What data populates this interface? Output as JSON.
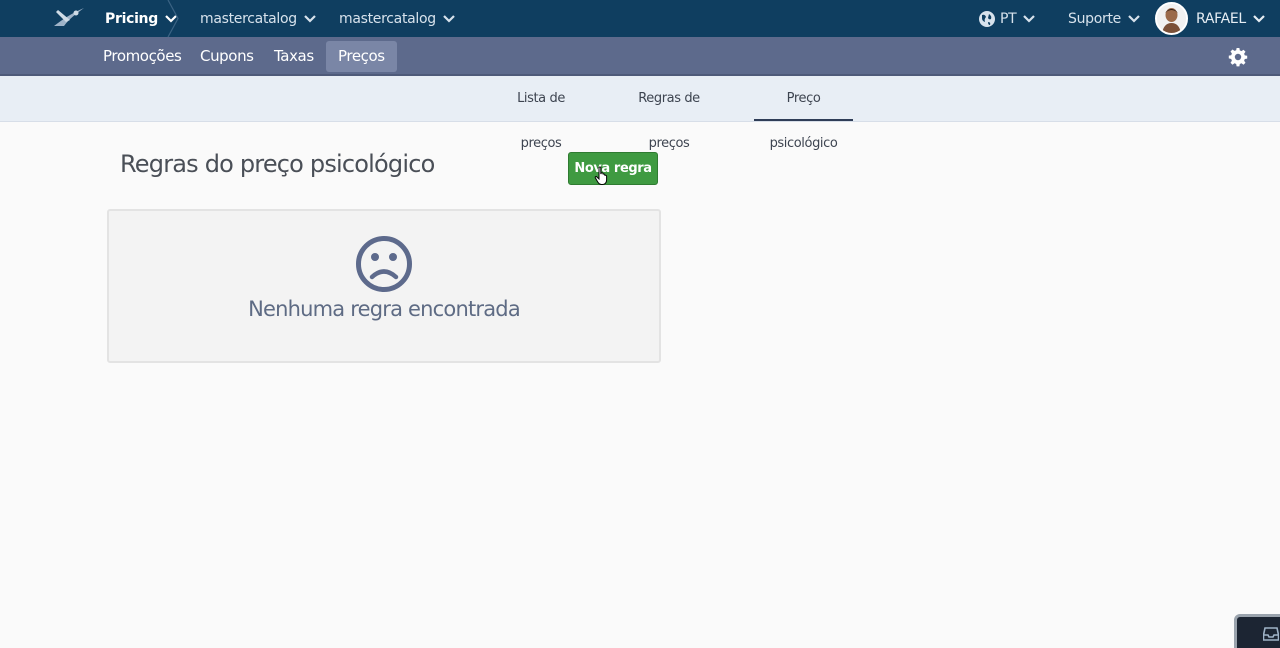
{
  "topbar": {
    "app_label": "Pricing",
    "breadcrumb": [
      "mastercatalog",
      "mastercatalog"
    ],
    "language": "PT",
    "support_label": "Suporte",
    "user_name": "RAFAEL"
  },
  "nav": {
    "items": [
      {
        "label": "Promoções",
        "active": false
      },
      {
        "label": "Cupons",
        "active": false
      },
      {
        "label": "Taxas",
        "active": false
      },
      {
        "label": "Preços",
        "active": true
      }
    ]
  },
  "subtabs": {
    "items": [
      {
        "label": "Lista de preços",
        "active": false
      },
      {
        "label": "Regras de preços",
        "active": false
      },
      {
        "label": "Preço psicológico",
        "active": true
      }
    ]
  },
  "main": {
    "title": "Regras do preço psicológico",
    "new_rule_button": "Nova regra",
    "empty_message": "Nenhuma regra encontrada"
  },
  "icons": [
    "logo-icon",
    "chevron-down-icon",
    "globe-icon",
    "avatar",
    "gear-icon",
    "sad-face-icon",
    "inbox-icon",
    "pointer-cursor-icon"
  ],
  "colors": {
    "topbar_bg": "#0f3e60",
    "navbar_bg": "#5d6a8c",
    "active_nav_bg": "#7a86a6",
    "subtabs_bg": "#e8eef5",
    "primary_button": "#3f9a41",
    "empty_icon": "#5d6a8c"
  }
}
